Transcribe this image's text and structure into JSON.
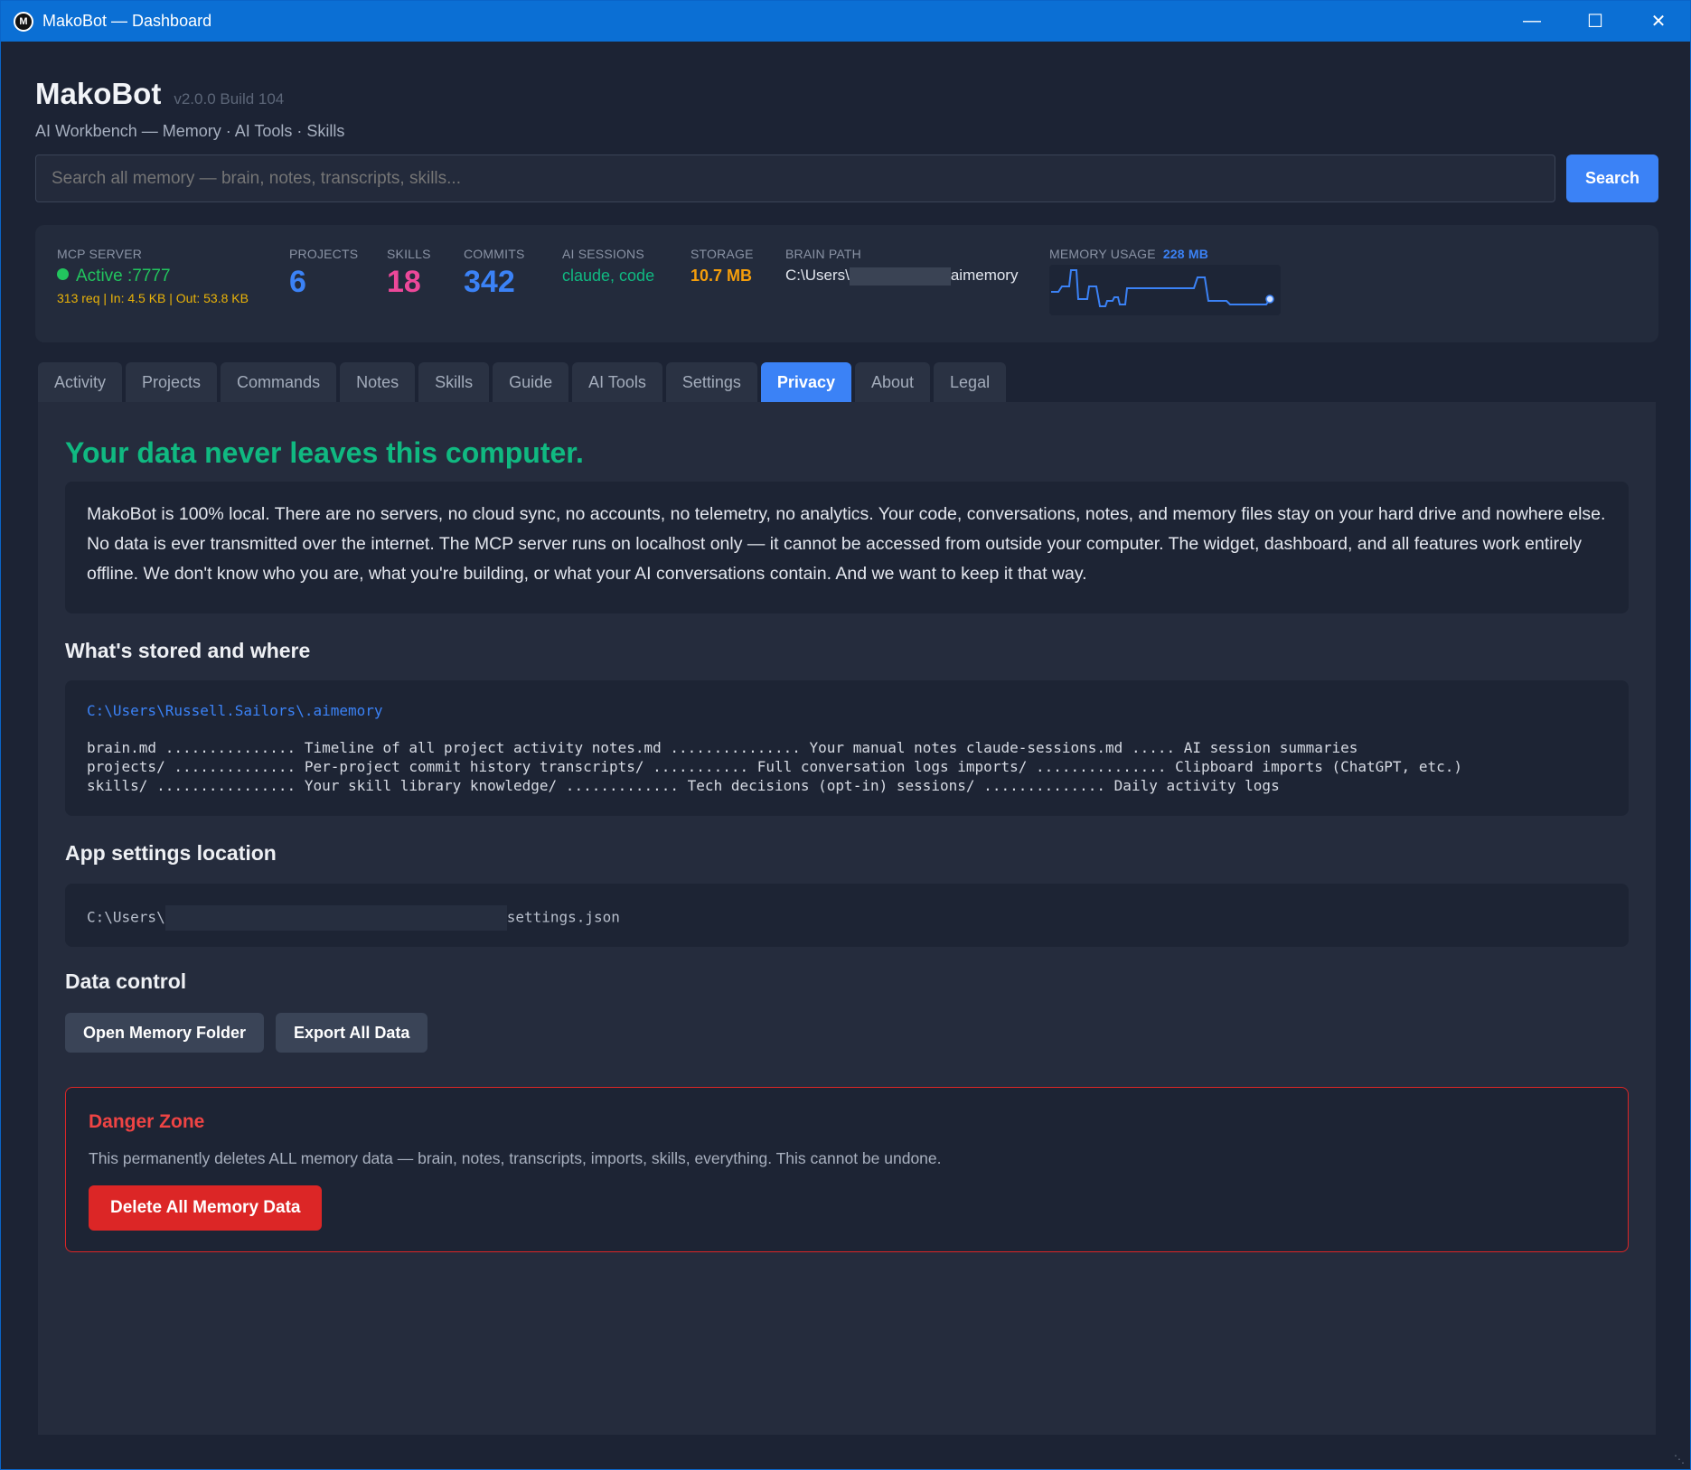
{
  "window": {
    "title": "MakoBot — Dashboard",
    "icon_letter": "M",
    "controls": [
      "minimize",
      "maximize",
      "close"
    ]
  },
  "header": {
    "app_name": "MakoBot",
    "version": "v2.0.0 Build 104",
    "tagline": "AI Workbench — Memory · AI Tools · Skills"
  },
  "search": {
    "placeholder": "Search all memory — brain, notes, transcripts, skills...",
    "button_label": "Search"
  },
  "stats": {
    "mcp": {
      "label": "MCP SERVER",
      "status": "Active :7777",
      "traffic": "313 req | In: 4.5 KB | Out: 53.8 KB",
      "status_color": "#22c55e"
    },
    "projects": {
      "label": "PROJECTS",
      "value": "6",
      "color": "#3b82f6"
    },
    "skills": {
      "label": "SKILLS",
      "value": "18",
      "color": "#ec4899"
    },
    "commits": {
      "label": "COMMITS",
      "value": "342",
      "color": "#3b82f6"
    },
    "ai_sessions": {
      "label": "AI SESSIONS",
      "value": "claude, code",
      "color": "#10b981"
    },
    "storage": {
      "label": "STORAGE",
      "value": "10.7 MB",
      "color": "#f59e0b"
    },
    "brain_path": {
      "label": "BRAIN PATH",
      "prefix": "C:\\Users\\",
      "suffix": "aimemory"
    },
    "memory_usage": {
      "label": "MEMORY USAGE",
      "value": "228 MB"
    }
  },
  "tabs": [
    {
      "label": "Activity",
      "active": false
    },
    {
      "label": "Projects",
      "active": false
    },
    {
      "label": "Commands",
      "active": false
    },
    {
      "label": "Notes",
      "active": false
    },
    {
      "label": "Skills",
      "active": false
    },
    {
      "label": "Guide",
      "active": false
    },
    {
      "label": "AI Tools",
      "active": false
    },
    {
      "label": "Settings",
      "active": false
    },
    {
      "label": "Privacy",
      "active": true
    },
    {
      "label": "About",
      "active": false
    },
    {
      "label": "Legal",
      "active": false
    }
  ],
  "privacy": {
    "hero": "Your data never leaves this computer.",
    "description": "MakoBot is 100% local. There are no servers, no cloud sync, no accounts, no telemetry, no analytics. Your code, conversations, notes, and memory files stay on your hard drive and nowhere else. No data is ever transmitted over the internet. The MCP server runs on localhost only — it cannot be accessed from outside your computer. The widget, dashboard, and all features work entirely offline. We don't know who you are, what you're building, or what your AI conversations contain. And we want to keep it that way.",
    "stored_heading": "What's stored and where",
    "stored_path": "C:\\Users\\Russell.Sailors\\.aimemory",
    "stored_lines": [
      "brain.md ............... Timeline of all project activity notes.md ............... Your manual notes claude-sessions.md ..... AI session summaries",
      "projects/ .............. Per-project commit history transcripts/ ........... Full conversation logs imports/ ............... Clipboard imports (ChatGPT, etc.)",
      "skills/ ................ Your skill library knowledge/ ............. Tech decisions (opt-in) sessions/ .............. Daily activity logs"
    ],
    "settings_heading": "App settings location",
    "settings_prefix": "C:\\Users\\",
    "settings_suffix": "settings.json",
    "control_heading": "Data control",
    "open_folder_label": "Open Memory Folder",
    "export_label": "Export All Data",
    "danger": {
      "title": "Danger Zone",
      "description": "This permanently deletes ALL memory data — brain, notes, transcripts, imports, skills, everything. This cannot be undone.",
      "button_label": "Delete All Memory Data"
    }
  }
}
